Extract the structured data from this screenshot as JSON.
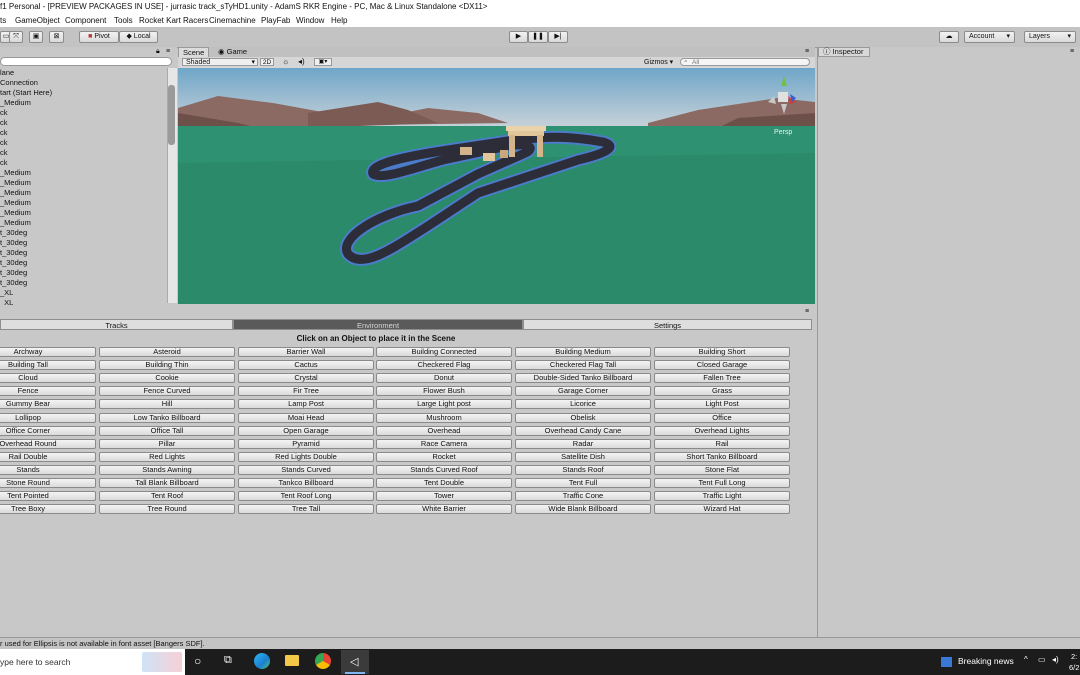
{
  "window": {
    "title": "f1 Personal - [PREVIEW PACKAGES IN USE] - jurrasic track_sTyHD1.unity - AdamS RKR Engine - PC, Mac & Linux Standalone <DX11>"
  },
  "menu": [
    "ts",
    "GameObject",
    "Component",
    "Tools",
    "Rocket Kart Racers",
    "Cinemachine",
    "PlayFab",
    "Window",
    "Help"
  ],
  "toolbar": {
    "pivot_label": "Pivot",
    "local_label": "Local",
    "account_label": "Account",
    "layers_label": "Layers"
  },
  "hierarchy": {
    "items": [
      "lane",
      "Connection",
      "tart (Start Here)",
      "_Medium",
      "ck",
      "ck",
      "ck",
      "ck",
      "ck",
      "ck",
      "_Medium",
      "_Medium",
      "_Medium",
      "_Medium",
      "_Medium",
      "_Medium",
      "t_30deg",
      "t_30deg",
      "t_30deg",
      "t_30deg",
      "t_30deg",
      "t_30deg",
      "_XL",
      "_XL"
    ]
  },
  "scene": {
    "tabs": [
      "Scene",
      "Game"
    ],
    "shading": "Shaded",
    "mode_2d": "2D",
    "gizmos_label": "Gizmos",
    "search_placeholder": "All",
    "persp_label": "Persp"
  },
  "inspector": {
    "tab_label": "Inspector"
  },
  "environment_panel": {
    "tabs": [
      "Tracks",
      "Environment",
      "Settings"
    ],
    "active_tab": "Environment",
    "instruction": "Click on an Object to place it in the Scene",
    "objects": [
      "Archway",
      "Asteroid",
      "Barrier Wall",
      "Building Connected",
      "Building Medium",
      "Building Short",
      "Building Tall",
      "Building Thin",
      "Cactus",
      "Checkered Flag",
      "Checkered Flag Tall",
      "Closed Garage",
      "Cloud",
      "Cookie",
      "Crystal",
      "Donut",
      "Double-Sided Tanko Billboard",
      "Fallen Tree",
      "Fence",
      "Fence Curved",
      "Fir Tree",
      "Flower Bush",
      "Garage Corner",
      "Grass",
      "Gummy Bear",
      "Hill",
      "Lamp Post",
      "Large Light post",
      "Licorice",
      "Light Post",
      "Lollipop",
      "Low Tanko Billboard",
      "Moai Head",
      "Mushroom",
      "Obelisk",
      "Office",
      "Office Corner",
      "Office Tall",
      "Open Garage",
      "Overhead",
      "Overhead Candy Cane",
      "Overhead Lights",
      "Overhead Round",
      "Pillar",
      "Pyramid",
      "Race Camera",
      "Radar",
      "Rail",
      "Rail Double",
      "Red Lights",
      "Red Lights Double",
      "Rocket",
      "Satellite Dish",
      "Short Tanko Billboard",
      "Stands",
      "Stands Awning",
      "Stands Curved",
      "Stands Curved Roof",
      "Stands Roof",
      "Stone Flat",
      "Stone Round",
      "Tall Blank Billboard",
      "Tankco Billboard",
      "Tent Double",
      "Tent Full",
      "Tent Full Long",
      "Tent Pointed",
      "Tent Roof",
      "Tent Roof Long",
      "Tower",
      "Traffic Cone",
      "Traffic Light",
      "Tree Boxy",
      "Tree Round",
      "Tree Tall",
      "White Barrier",
      "Wide Blank Billboard",
      "Wizard Hat"
    ]
  },
  "status_bar": {
    "message": "r used for Ellipsis is not available in font asset [Bangers SDF]."
  },
  "taskbar": {
    "search_placeholder": "ype here to search",
    "news_label": "Breaking news",
    "clock_time": "2:",
    "clock_date": "6/2"
  },
  "colors": {
    "ground": "#2a8a6a",
    "sky_top": "#6fa6c8",
    "track": "#2d2d3a",
    "track_edge": "#4a7cc9",
    "active_tab": "#5a5a5a"
  }
}
